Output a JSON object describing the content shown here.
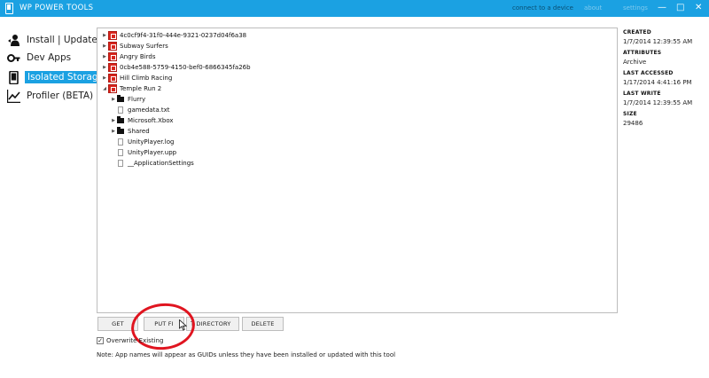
{
  "window": {
    "title": "WP POWER TOOLS",
    "links": [
      "connect to a device",
      "about",
      "settings"
    ],
    "controls": [
      "—",
      "□",
      "✕"
    ]
  },
  "sidebar": {
    "items": [
      {
        "label": "Install | Update",
        "icon": "person-icon",
        "active": false
      },
      {
        "label": "Dev Apps",
        "icon": "key-icon",
        "active": false
      },
      {
        "label": "Isolated Storage",
        "icon": "phone-icon",
        "active": true
      },
      {
        "label": "Profiler (BETA)",
        "icon": "chart-icon",
        "active": false
      }
    ]
  },
  "tree": {
    "apps": [
      {
        "name": "4c0cf9f4-31f0-444e-9321-0237d04f6a38",
        "expanded": false
      },
      {
        "name": "Subway Surfers",
        "expanded": false
      },
      {
        "name": "Angry Birds",
        "expanded": false
      },
      {
        "name": "0cb4e588-5759-4150-bef0-6866345fa26b",
        "expanded": false
      },
      {
        "name": "Hill Climb Racing",
        "expanded": false
      },
      {
        "name": "Temple Run 2",
        "expanded": true
      }
    ],
    "children": [
      {
        "name": "Flurry",
        "type": "folder"
      },
      {
        "name": "gamedata.txt",
        "type": "file"
      },
      {
        "name": "Microsoft.Xbox",
        "type": "folder"
      },
      {
        "name": "Shared",
        "type": "folder"
      },
      {
        "name": "UnityPlayer.log",
        "type": "file"
      },
      {
        "name": "UnityPlayer.upp",
        "type": "file"
      },
      {
        "name": "__ApplicationSettings",
        "type": "file"
      }
    ]
  },
  "info": {
    "created_label": "CREATED",
    "created_value": "1/7/2014 12:39:55 AM",
    "attributes_label": "ATTRIBUTES",
    "attributes_value": "Archive",
    "last_accessed_label": "LAST ACCESSED",
    "last_accessed_value": "1/17/2014 4:41:16 PM",
    "last_write_label": "LAST WRITE",
    "last_write_value": "1/7/2014 12:39:55 AM",
    "size_label": "SIZE",
    "size_value": "29486"
  },
  "actions": {
    "get_label": "GET",
    "put_file_label": "PUT FI",
    "put_directory_label": "T DIRECTORY",
    "delete_label": "DELETE"
  },
  "options": {
    "overwrite_label": "Overwrite Existing",
    "overwrite_checked": true
  },
  "note": "Note: App names will appear as GUIDs unless they have been installed or updated with this tool",
  "colors": {
    "accent": "#1ba1e2",
    "app_icon": "#d9251d",
    "annotation": "#e01520"
  }
}
